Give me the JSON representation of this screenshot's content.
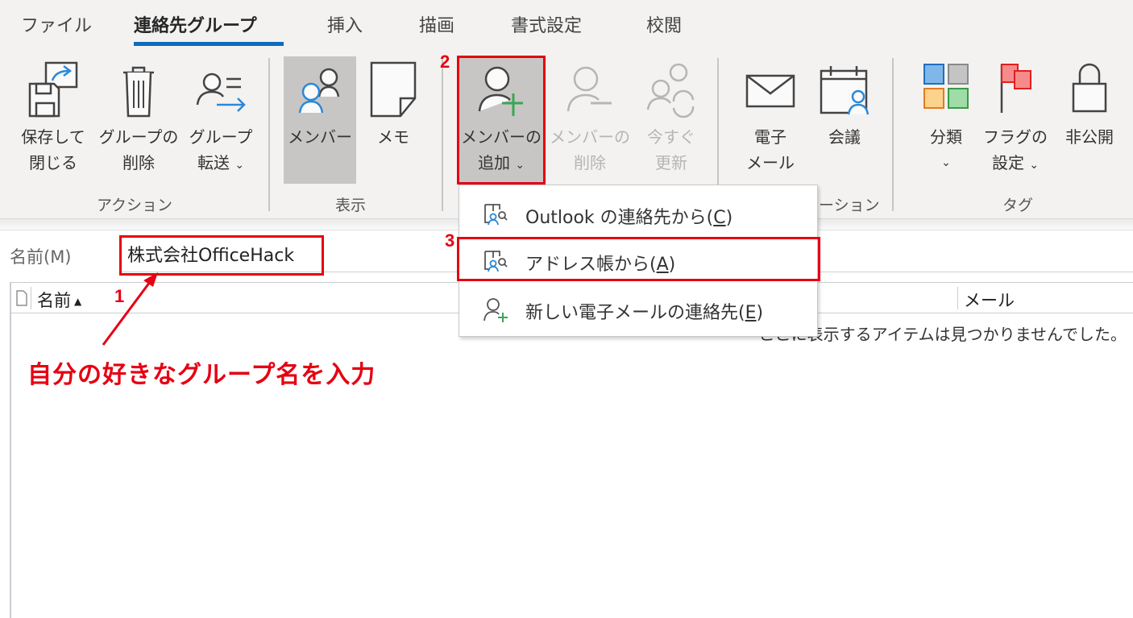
{
  "tabs": [
    {
      "label": "ファイル",
      "active": false
    },
    {
      "label": "連絡先グループ",
      "active": true
    },
    {
      "label": "挿入",
      "active": false
    },
    {
      "label": "描画",
      "active": false
    },
    {
      "label": "書式設定",
      "active": false
    },
    {
      "label": "校閲",
      "active": false
    }
  ],
  "accent_color": "#0f6cbd",
  "highlight_color": "#e60012",
  "ribbon": {
    "groups": {
      "actions": "アクション",
      "display": "表示",
      "communication": "ーション",
      "tags": "タグ"
    },
    "buttons": {
      "save_close": {
        "line1": "保存して",
        "line2": "閉じる",
        "icon": "save-close-icon"
      },
      "delete_group": {
        "line1": "グループの",
        "line2": "削除",
        "icon": "trash-icon"
      },
      "forward_group": {
        "line1": "グループ",
        "line2": "転送",
        "icon": "forward-contact-icon",
        "chevron": "⌄"
      },
      "members": {
        "line1": "メンバー",
        "icon": "members-icon",
        "selected": true
      },
      "notes": {
        "line1": "メモ",
        "icon": "note-icon"
      },
      "add_members": {
        "line1": "メンバーの",
        "line2": "追加",
        "icon": "add-person-icon",
        "chevron": "⌄"
      },
      "remove_member": {
        "line1": "メンバーの",
        "line2": "削除",
        "icon": "remove-person-icon",
        "disabled": true
      },
      "update_now": {
        "line1": "今すぐ",
        "line2": "更新",
        "icon": "refresh-people-icon",
        "disabled": true
      },
      "email": {
        "line1": "電子",
        "line2": "メール",
        "icon": "envelope-icon"
      },
      "meeting": {
        "line1": "会議",
        "icon": "calendar-person-icon"
      },
      "categorize": {
        "line1": "分類",
        "line2": "⌄",
        "icon": "categories-icon"
      },
      "follow_up": {
        "line1": "フラグの",
        "line2": "設定",
        "icon": "flag-icon",
        "chevron": "⌄"
      },
      "private": {
        "line1": "非公開",
        "icon": "lock-icon"
      }
    }
  },
  "add_members_menu": {
    "items": [
      {
        "text": "Outlook の連絡先から(",
        "key": "C",
        "suffix": ")",
        "icon": "address-book-icon"
      },
      {
        "text": "アドレス帳から(",
        "key": "A",
        "suffix": ")",
        "icon": "address-book-icon"
      },
      {
        "text": "新しい電子メールの連絡先(",
        "key": "E",
        "suffix": ")",
        "icon": "new-contact-icon"
      }
    ]
  },
  "form": {
    "name_label": "名前(M)",
    "name_value": "株式会社OfficeHack"
  },
  "member_list": {
    "columns": [
      {
        "label": "名前",
        "sort": "▲"
      },
      {
        "label": "メール"
      }
    ],
    "empty_message": "ここに表示するアイテムは見つかりませんでした。"
  },
  "annotations": {
    "step1": "1",
    "step2": "2",
    "step3": "3",
    "instruction": "自分の好きなグループ名を入力"
  }
}
